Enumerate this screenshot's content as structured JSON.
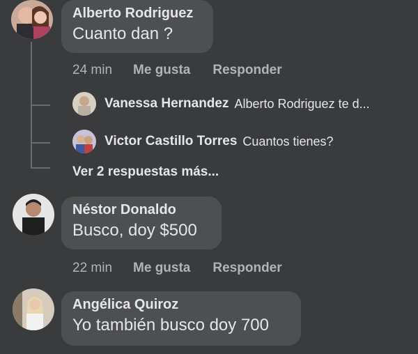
{
  "comments": [
    {
      "author": "Alberto Rodriguez",
      "text": "Cuanto dan ?",
      "time": "24 min",
      "like": "Me gusta",
      "reply": "Responder"
    },
    {
      "author": "Néstor Donaldo",
      "text": "Busco, doy $500",
      "time": "22 min",
      "like": "Me gusta",
      "reply": "Responder"
    },
    {
      "author": "Angélica Quiroz",
      "text": "Yo también busco doy 700"
    }
  ],
  "replies": [
    {
      "author": "Vanessa Hernandez",
      "text": "Alberto Rodriguez te d..."
    },
    {
      "author": "Victor Castillo Torres",
      "text": "Cuantos tienes?"
    }
  ],
  "more_replies": "Ver 2 respuestas más...",
  "colors": {
    "background": "#3a3b3d",
    "bubble": "#4e4f50",
    "text": "#e4e6eb",
    "muted": "#b0b3b8"
  }
}
